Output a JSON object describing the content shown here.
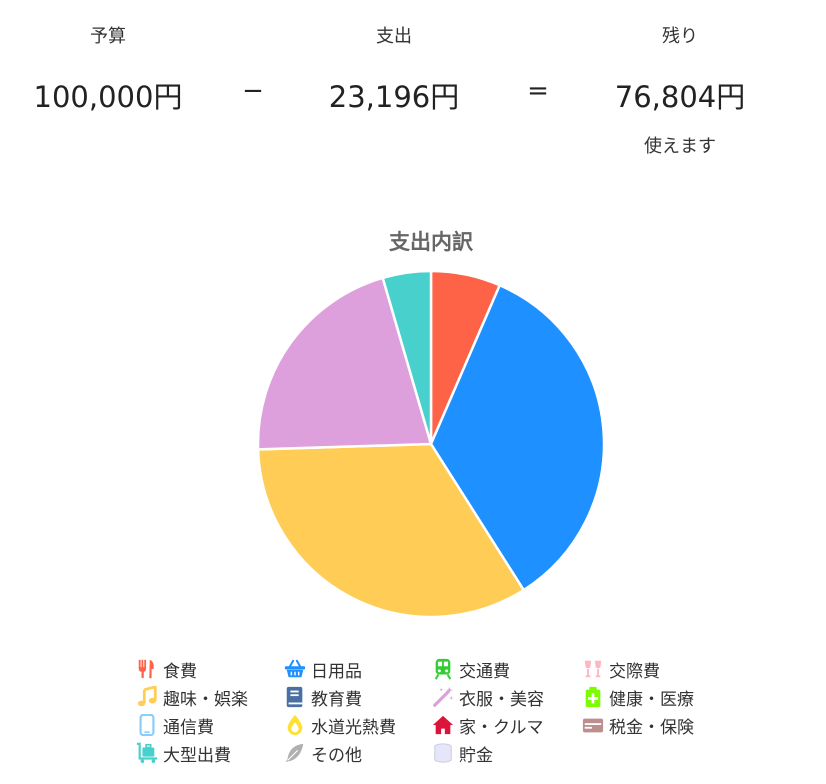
{
  "summary": {
    "budget": {
      "label": "予算",
      "amount": "100,000円"
    },
    "minus_operator": "−",
    "spent": {
      "label": "支出",
      "amount": "23,196円"
    },
    "equals_operator": "=",
    "remaining": {
      "label": "残り",
      "amount": "76,804円",
      "note": "使えます"
    }
  },
  "chart_data": {
    "type": "pie",
    "title": "支出内訳",
    "slices": [
      {
        "value": 6.5,
        "color": "#FF6347"
      },
      {
        "value": 34.5,
        "color": "#1E90FF"
      },
      {
        "value": 33.5,
        "color": "#FFCC55"
      },
      {
        "value": 21.0,
        "color": "#DDA0DD"
      },
      {
        "value": 4.5,
        "color": "#48D1CC"
      }
    ]
  },
  "legend": [
    {
      "label": "食費",
      "icon": "utensils-icon",
      "color": "#FF6347"
    },
    {
      "label": "日用品",
      "icon": "shopping-basket-icon",
      "color": "#1E90FF"
    },
    {
      "label": "交通費",
      "icon": "train-icon",
      "color": "#32CD32"
    },
    {
      "label": "交際費",
      "icon": "glasses-cheers-icon",
      "color": "#FFB6C1"
    },
    {
      "label": "趣味・娯楽",
      "icon": "music-note-icon",
      "color": "#FFCC55"
    },
    {
      "label": "教育費",
      "icon": "book-icon",
      "color": "#4A6FA5"
    },
    {
      "label": "衣服・美容",
      "icon": "magic-wand-icon",
      "color": "#DDA0DD"
    },
    {
      "label": "健康・医療",
      "icon": "medkit-icon",
      "color": "#7CFC00"
    },
    {
      "label": "通信費",
      "icon": "mobile-phone-icon",
      "color": "#87CEFA"
    },
    {
      "label": "水道光熱費",
      "icon": "fire-drop-icon",
      "color": "#FFE033"
    },
    {
      "label": "家・クルマ",
      "icon": "house-icon",
      "color": "#DC143C"
    },
    {
      "label": "税金・保険",
      "icon": "money-bill-icon",
      "color": "#BC8F8F"
    },
    {
      "label": "大型出費",
      "icon": "luggage-cart-icon",
      "color": "#48D1CC"
    },
    {
      "label": "その他",
      "icon": "feather-icon",
      "color": "#B0B0B0"
    },
    {
      "label": "貯金",
      "icon": "coins-icon",
      "color": "#E6E6FA"
    }
  ]
}
